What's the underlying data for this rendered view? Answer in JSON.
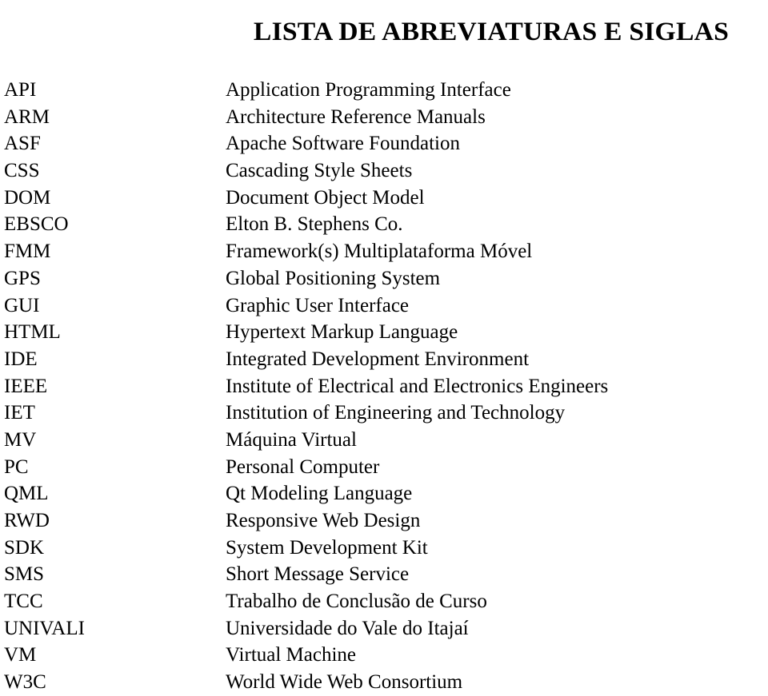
{
  "document": {
    "heading": "LISTA DE ABREVIATURAS E SIGLAS",
    "background_color": "#ffffff",
    "text_color": "#000000"
  },
  "abbreviations": [
    {
      "term": "API",
      "definition": "Application Programming Interface"
    },
    {
      "term": "ARM",
      "definition": "Architecture Reference Manuals"
    },
    {
      "term": "ASF",
      "definition": "Apache Software Foundation"
    },
    {
      "term": "CSS",
      "definition": "Cascading Style Sheets"
    },
    {
      "term": "DOM",
      "definition": "Document Object Model"
    },
    {
      "term": "EBSCO",
      "definition": "Elton B. Stephens Co."
    },
    {
      "term": "FMM",
      "definition": "Framework(s) Multiplataforma Móvel"
    },
    {
      "term": "GPS",
      "definition": "Global Positioning System"
    },
    {
      "term": "GUI",
      "definition": "Graphic User Interface"
    },
    {
      "term": "HTML",
      "definition": "Hypertext Markup Language"
    },
    {
      "term": "IDE",
      "definition": "Integrated Development Environment"
    },
    {
      "term": "IEEE",
      "definition": "Institute of Electrical and Electronics Engineers"
    },
    {
      "term": "IET",
      "definition": "Institution of Engineering and Technology"
    },
    {
      "term": "MV",
      "definition": "Máquina Virtual"
    },
    {
      "term": "PC",
      "definition": "Personal Computer"
    },
    {
      "term": "QML",
      "definition": "Qt Modeling Language"
    },
    {
      "term": "RWD",
      "definition": "Responsive Web Design"
    },
    {
      "term": "SDK",
      "definition": "System Development Kit"
    },
    {
      "term": "SMS",
      "definition": "Short Message Service"
    },
    {
      "term": "TCC",
      "definition": "Trabalho de Conclusão de Curso"
    },
    {
      "term": "UNIVALI",
      "definition": "Universidade do Vale do Itajaí"
    },
    {
      "term": "VM",
      "definition": "Virtual Machine"
    },
    {
      "term": "W3C",
      "definition": "World Wide Web Consortium"
    }
  ]
}
